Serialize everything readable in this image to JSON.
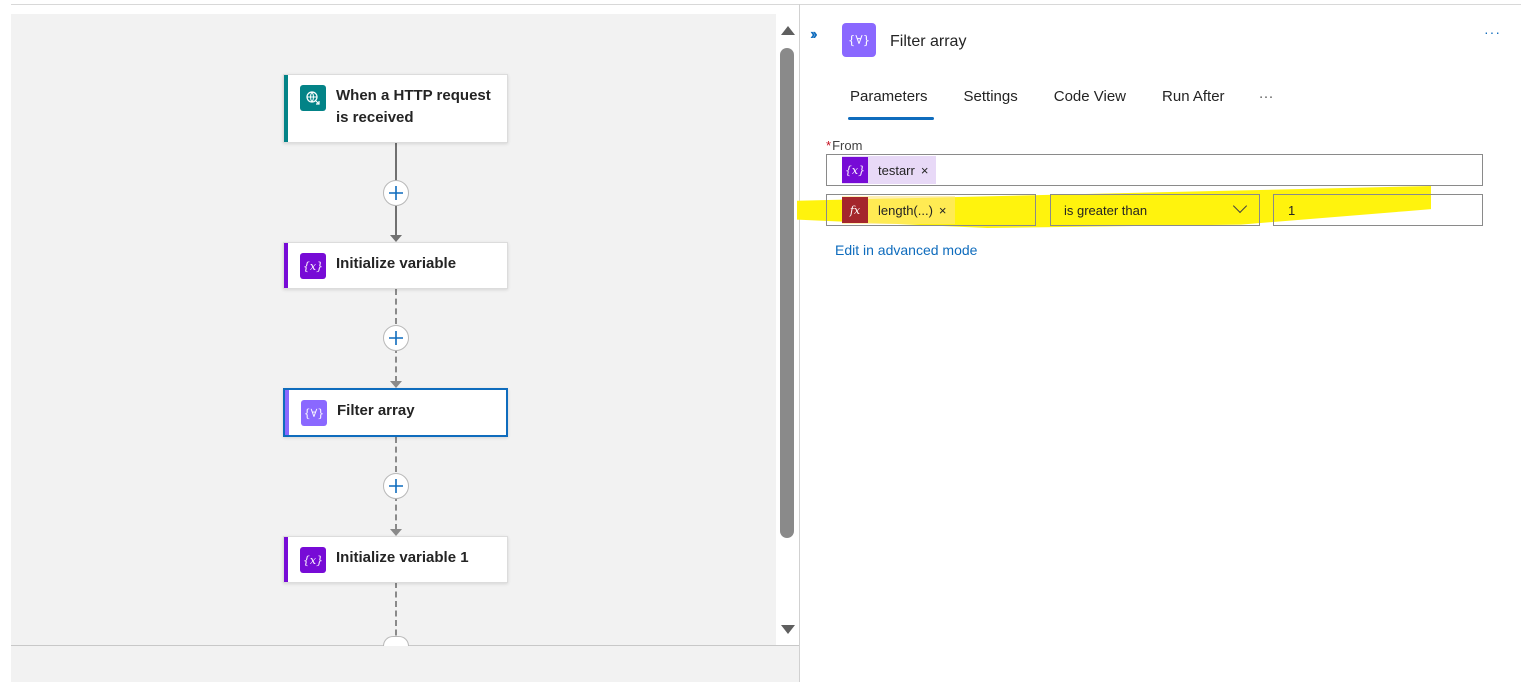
{
  "canvas": {
    "nodes": [
      {
        "title": "When a HTTP request is received",
        "icon": "http-request-globe-icon",
        "accent": "#038387",
        "icon_bg": "#038387"
      },
      {
        "title": "Initialize variable",
        "icon": "variable-icon",
        "icon_glyph": "{x}",
        "accent": "#770bd6",
        "icon_bg": "#770bd6"
      },
      {
        "title": "Filter array",
        "icon": "filter-array-icon",
        "icon_glyph": "{∀}",
        "accent": "#8a68ff",
        "icon_bg": "#8a68ff",
        "selected": true
      },
      {
        "title": "Initialize variable 1",
        "icon": "variable-icon",
        "icon_glyph": "{x}",
        "accent": "#770bd6",
        "icon_bg": "#770bd6"
      }
    ]
  },
  "panel": {
    "title": "Filter array",
    "icon_glyph": "{∀}",
    "more_label": "···",
    "tabs": [
      {
        "label": "Parameters",
        "active": true
      },
      {
        "label": "Settings"
      },
      {
        "label": "Code View"
      },
      {
        "label": "Run After"
      }
    ],
    "tabs_more": "···",
    "from": {
      "required_marker": "*",
      "label": "From",
      "token": {
        "glyph": "{x}",
        "label": "testarr",
        "remove": "×",
        "color": "#770bd6"
      }
    },
    "condition": {
      "left_token": {
        "glyph": "fx",
        "label": "length(...)",
        "remove": "×",
        "color": "#a4262c"
      },
      "operator": "is greater than",
      "right_value": "1"
    },
    "advanced_link": "Edit in advanced mode"
  },
  "colors": {
    "link": "#0f6cbd",
    "highlight": "#fff200"
  }
}
